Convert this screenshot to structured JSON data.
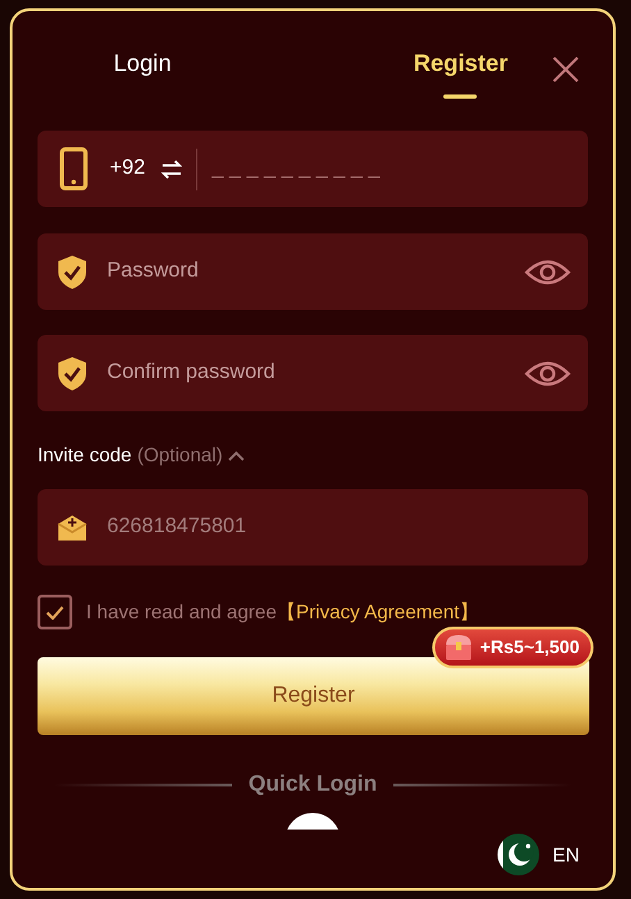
{
  "tabs": [
    {
      "label": "Login",
      "selected": false
    },
    {
      "label": "Register",
      "selected": true
    }
  ],
  "phone": {
    "country_code": "+92",
    "placeholder": "_ _ _ _ _ _ _ _ _ _"
  },
  "password_fields": [
    {
      "placeholder": "Password"
    },
    {
      "placeholder": "Confirm password"
    }
  ],
  "invite": {
    "label": "Invite code",
    "hint": "(Optional)",
    "expanded": true,
    "value": "626818475801"
  },
  "agreement": {
    "checked": true,
    "text": "I have read and agree",
    "link": "【Privacy Agreement】"
  },
  "register_button": {
    "label": "Register",
    "bonus_badge": "+Rs5~1,500"
  },
  "quick_login": {
    "label": "Quick Login"
  },
  "language": {
    "code": "EN"
  }
}
